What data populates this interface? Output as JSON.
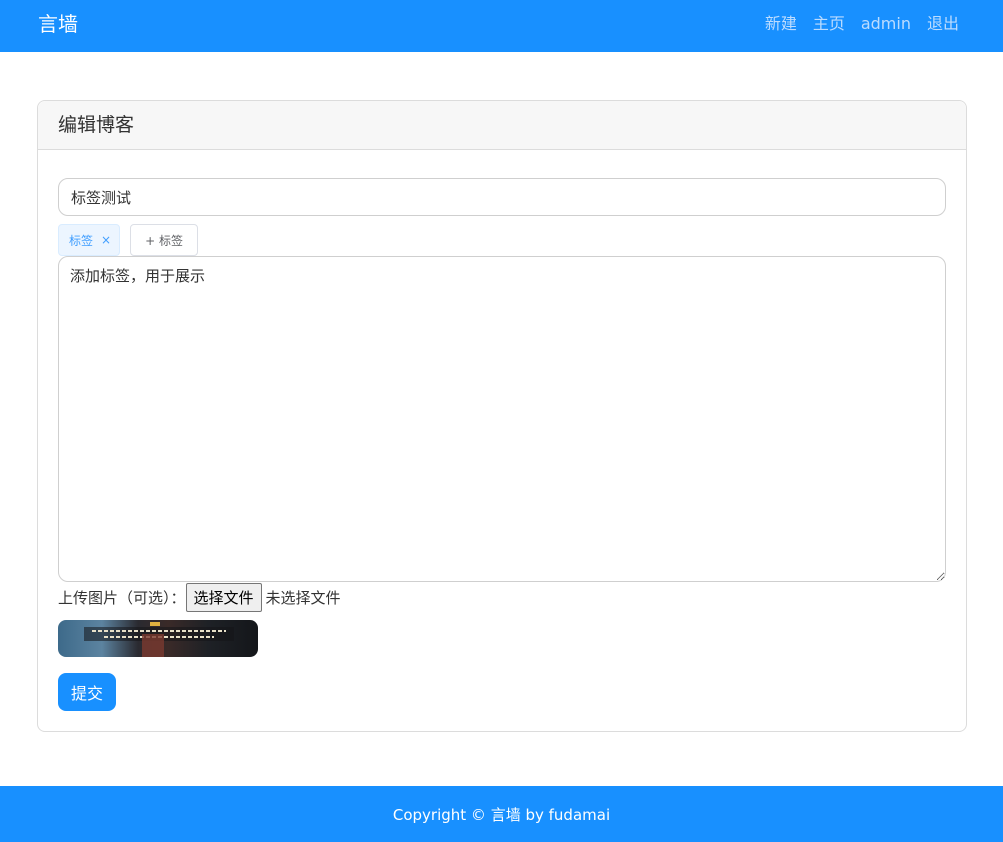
{
  "navbar": {
    "brand": "言墙",
    "links": [
      "新建",
      "主页",
      "admin",
      "退出"
    ]
  },
  "card": {
    "title": "编辑博客",
    "title_input_value": "标签测试",
    "tags": [
      {
        "label": "标签",
        "close_icon": "×"
      }
    ],
    "add_tag_label": "+ 标签",
    "content_value": "添加标签，用于展示",
    "upload": {
      "label": "上传图片（可选）：",
      "button": "选择文件",
      "status": "未选择文件"
    },
    "submit_label": "提交"
  },
  "footer": {
    "text": "Copyright © 言墙 by fudamai"
  },
  "colors": {
    "primary": "#1890ff",
    "tag_bg": "#ecf5ff",
    "tag_text": "#409eff"
  }
}
